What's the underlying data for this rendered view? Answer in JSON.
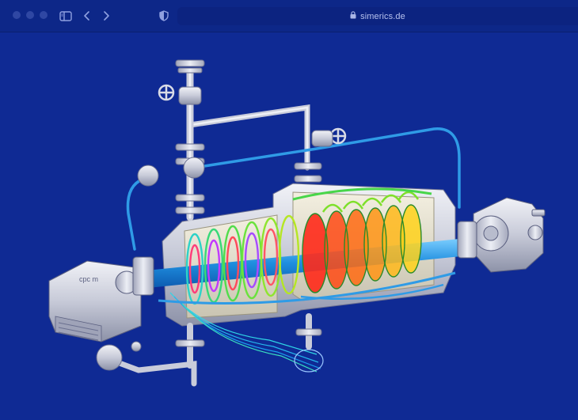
{
  "browser": {
    "url": "simerics.de",
    "icons": {
      "sidebar": "sidebar-toggle-icon",
      "back": "chevron-left-icon",
      "forward": "chevron-right-icon",
      "privacy": "shield-icon",
      "lock": "lock-icon"
    }
  },
  "illustration": {
    "subject": "compressor CFD flow visualization",
    "motor_nameplate": "cpc m"
  },
  "colors": {
    "background": "#0f2a94",
    "titlebar": "#0d2788",
    "pipe_blue": "#2f9be6"
  }
}
